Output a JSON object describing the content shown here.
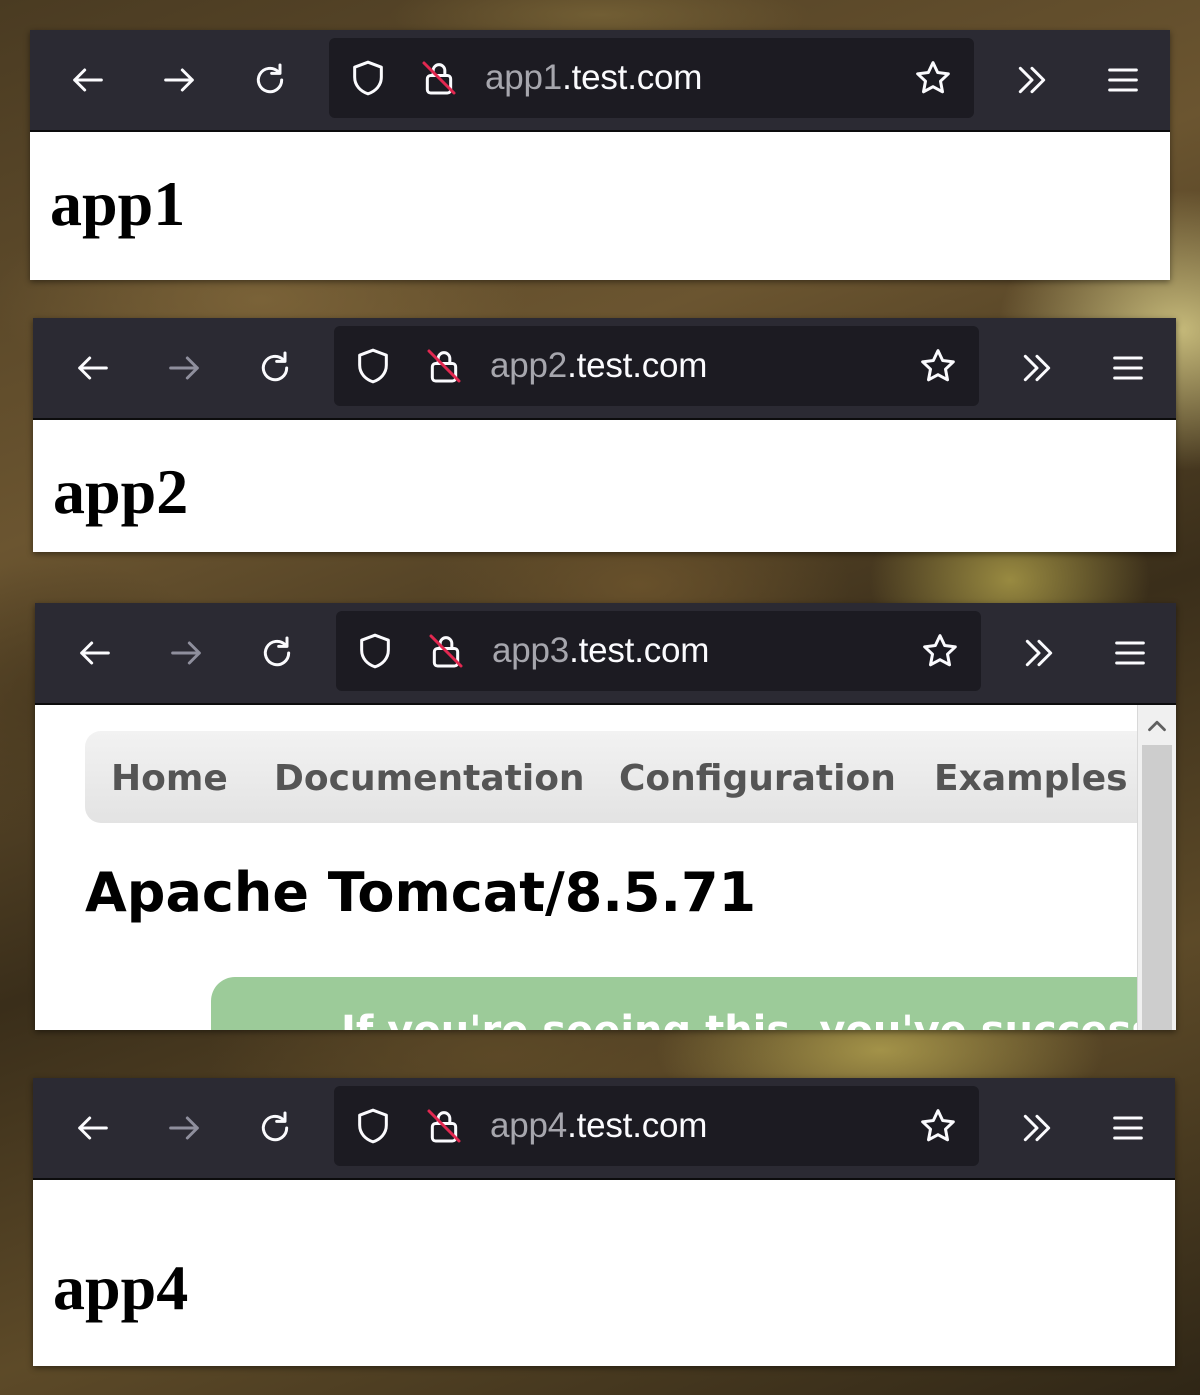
{
  "windows": [
    {
      "host_sub": "app1",
      "host_domain": ".test.com",
      "heading": "app1",
      "forward_enabled": true
    },
    {
      "host_sub": "app2",
      "host_domain": ".test.com",
      "heading": "app2",
      "forward_enabled": false
    },
    {
      "host_sub": "app3",
      "host_domain": ".test.com",
      "forward_enabled": false,
      "tomcat": {
        "nav": [
          "Home",
          "Documentation",
          "Configuration",
          "Examples"
        ],
        "title": "Apache Tomcat/8.5.71",
        "banner": "If you're seeing this, you've successfully installed Tomcat."
      }
    },
    {
      "host_sub": "app4",
      "host_domain": ".test.com",
      "heading": "app4",
      "forward_enabled": false
    }
  ],
  "icons": {
    "back": "back-arrow-icon",
    "forward": "forward-arrow-icon",
    "reload": "reload-icon",
    "tracking": "shield-icon",
    "insecure": "insecure-lock-icon",
    "bookmark": "star-icon",
    "overflow": "chevron-double-right-icon",
    "menu": "hamburger-menu-icon"
  },
  "colors": {
    "toolbar": "#2b2a33",
    "urlbar": "#1c1b22",
    "icon": "#fbfbfe",
    "disabled_icon": "#8f8f9d",
    "insecure_strike": "#e22850",
    "tomcat_banner": "#9ccb99"
  }
}
